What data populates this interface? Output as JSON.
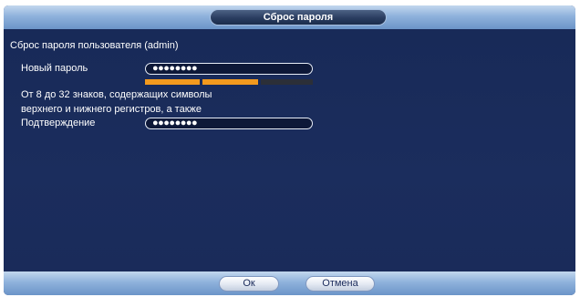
{
  "dialog": {
    "title": "Сброс пароля"
  },
  "form": {
    "user_reset_label": "Сброс пароля пользователя (admin)",
    "new_password_label": "Новый пароль",
    "new_password_value": "●●●●●●●●",
    "strength_levels": 3,
    "strength_filled": 2,
    "hint_line1": "От 8 до 32 знаков, содержащих символы",
    "hint_line2": "верхнего и нижнего регистров, а также",
    "confirm_label": "Подтверждение",
    "confirm_value": "●●●●●●●●"
  },
  "footer": {
    "ok_label": "Ок",
    "cancel_label": "Отмена"
  },
  "colors": {
    "strength_filled": "#f39a1e",
    "strength_empty": "#2b2f38",
    "background": "#1a2a5a"
  }
}
